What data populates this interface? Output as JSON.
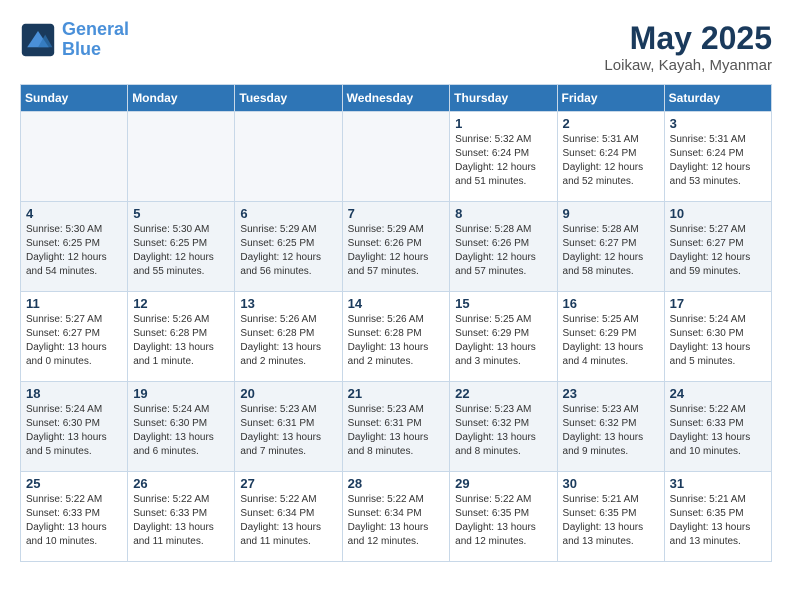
{
  "logo": {
    "line1": "General",
    "line2": "Blue"
  },
  "title": "May 2025",
  "location": "Loikaw, Kayah, Myanmar",
  "weekdays": [
    "Sunday",
    "Monday",
    "Tuesday",
    "Wednesday",
    "Thursday",
    "Friday",
    "Saturday"
  ],
  "weeks": [
    [
      {
        "day": "",
        "info": ""
      },
      {
        "day": "",
        "info": ""
      },
      {
        "day": "",
        "info": ""
      },
      {
        "day": "",
        "info": ""
      },
      {
        "day": "1",
        "info": "Sunrise: 5:32 AM\nSunset: 6:24 PM\nDaylight: 12 hours\nand 51 minutes."
      },
      {
        "day": "2",
        "info": "Sunrise: 5:31 AM\nSunset: 6:24 PM\nDaylight: 12 hours\nand 52 minutes."
      },
      {
        "day": "3",
        "info": "Sunrise: 5:31 AM\nSunset: 6:24 PM\nDaylight: 12 hours\nand 53 minutes."
      }
    ],
    [
      {
        "day": "4",
        "info": "Sunrise: 5:30 AM\nSunset: 6:25 PM\nDaylight: 12 hours\nand 54 minutes."
      },
      {
        "day": "5",
        "info": "Sunrise: 5:30 AM\nSunset: 6:25 PM\nDaylight: 12 hours\nand 55 minutes."
      },
      {
        "day": "6",
        "info": "Sunrise: 5:29 AM\nSunset: 6:25 PM\nDaylight: 12 hours\nand 56 minutes."
      },
      {
        "day": "7",
        "info": "Sunrise: 5:29 AM\nSunset: 6:26 PM\nDaylight: 12 hours\nand 57 minutes."
      },
      {
        "day": "8",
        "info": "Sunrise: 5:28 AM\nSunset: 6:26 PM\nDaylight: 12 hours\nand 57 minutes."
      },
      {
        "day": "9",
        "info": "Sunrise: 5:28 AM\nSunset: 6:27 PM\nDaylight: 12 hours\nand 58 minutes."
      },
      {
        "day": "10",
        "info": "Sunrise: 5:27 AM\nSunset: 6:27 PM\nDaylight: 12 hours\nand 59 minutes."
      }
    ],
    [
      {
        "day": "11",
        "info": "Sunrise: 5:27 AM\nSunset: 6:27 PM\nDaylight: 13 hours\nand 0 minutes."
      },
      {
        "day": "12",
        "info": "Sunrise: 5:26 AM\nSunset: 6:28 PM\nDaylight: 13 hours\nand 1 minute."
      },
      {
        "day": "13",
        "info": "Sunrise: 5:26 AM\nSunset: 6:28 PM\nDaylight: 13 hours\nand 2 minutes."
      },
      {
        "day": "14",
        "info": "Sunrise: 5:26 AM\nSunset: 6:28 PM\nDaylight: 13 hours\nand 2 minutes."
      },
      {
        "day": "15",
        "info": "Sunrise: 5:25 AM\nSunset: 6:29 PM\nDaylight: 13 hours\nand 3 minutes."
      },
      {
        "day": "16",
        "info": "Sunrise: 5:25 AM\nSunset: 6:29 PM\nDaylight: 13 hours\nand 4 minutes."
      },
      {
        "day": "17",
        "info": "Sunrise: 5:24 AM\nSunset: 6:30 PM\nDaylight: 13 hours\nand 5 minutes."
      }
    ],
    [
      {
        "day": "18",
        "info": "Sunrise: 5:24 AM\nSunset: 6:30 PM\nDaylight: 13 hours\nand 5 minutes."
      },
      {
        "day": "19",
        "info": "Sunrise: 5:24 AM\nSunset: 6:30 PM\nDaylight: 13 hours\nand 6 minutes."
      },
      {
        "day": "20",
        "info": "Sunrise: 5:23 AM\nSunset: 6:31 PM\nDaylight: 13 hours\nand 7 minutes."
      },
      {
        "day": "21",
        "info": "Sunrise: 5:23 AM\nSunset: 6:31 PM\nDaylight: 13 hours\nand 8 minutes."
      },
      {
        "day": "22",
        "info": "Sunrise: 5:23 AM\nSunset: 6:32 PM\nDaylight: 13 hours\nand 8 minutes."
      },
      {
        "day": "23",
        "info": "Sunrise: 5:23 AM\nSunset: 6:32 PM\nDaylight: 13 hours\nand 9 minutes."
      },
      {
        "day": "24",
        "info": "Sunrise: 5:22 AM\nSunset: 6:33 PM\nDaylight: 13 hours\nand 10 minutes."
      }
    ],
    [
      {
        "day": "25",
        "info": "Sunrise: 5:22 AM\nSunset: 6:33 PM\nDaylight: 13 hours\nand 10 minutes."
      },
      {
        "day": "26",
        "info": "Sunrise: 5:22 AM\nSunset: 6:33 PM\nDaylight: 13 hours\nand 11 minutes."
      },
      {
        "day": "27",
        "info": "Sunrise: 5:22 AM\nSunset: 6:34 PM\nDaylight: 13 hours\nand 11 minutes."
      },
      {
        "day": "28",
        "info": "Sunrise: 5:22 AM\nSunset: 6:34 PM\nDaylight: 13 hours\nand 12 minutes."
      },
      {
        "day": "29",
        "info": "Sunrise: 5:22 AM\nSunset: 6:35 PM\nDaylight: 13 hours\nand 12 minutes."
      },
      {
        "day": "30",
        "info": "Sunrise: 5:21 AM\nSunset: 6:35 PM\nDaylight: 13 hours\nand 13 minutes."
      },
      {
        "day": "31",
        "info": "Sunrise: 5:21 AM\nSunset: 6:35 PM\nDaylight: 13 hours\nand 13 minutes."
      }
    ]
  ]
}
